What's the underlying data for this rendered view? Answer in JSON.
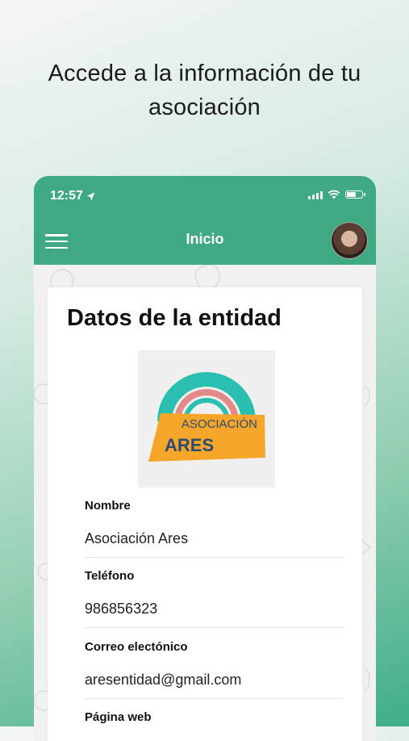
{
  "promo": {
    "line1": "Accede a la información de tu",
    "line2": "asociación"
  },
  "status_bar": {
    "time": "12:57",
    "location_icon": "location-arrow-icon",
    "signal_icon": "signal-icon",
    "wifi_icon": "wifi-icon",
    "battery_icon": "battery-icon"
  },
  "nav": {
    "title": "Inicio",
    "menu_icon": "hamburger-menu-icon",
    "avatar": "user-avatar"
  },
  "colors": {
    "header": "#3faa82",
    "logo_teal": "#2bbfb1",
    "logo_pink": "#e48a86",
    "logo_yellow": "#f6a62a",
    "logo_text": "#2e4b6f"
  },
  "card": {
    "title": "Datos de la entidad",
    "logo": {
      "line1": "ASOCIACIÓN",
      "line2": "ARES"
    },
    "fields": [
      {
        "label": "Nombre",
        "value": "Asociación Ares"
      },
      {
        "label": "Teléfono",
        "value": "986856323"
      },
      {
        "label": "Correo electónico",
        "value": "aresentidad@gmail.com"
      },
      {
        "label": "Página web",
        "value": ""
      }
    ]
  }
}
